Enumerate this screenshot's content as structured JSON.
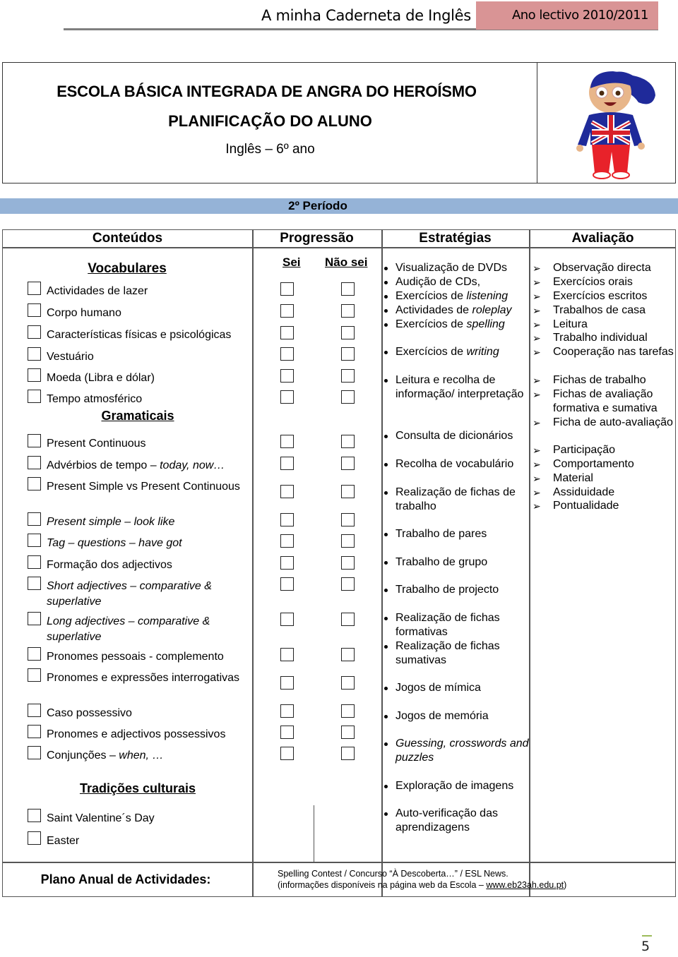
{
  "header": {
    "notebook_title": "A minha Caderneta de Inglês",
    "school_year": "Ano lectivo 2010/2011"
  },
  "school": {
    "name": "ESCOLA BÁSICA INTEGRADA DE ANGRA DO HEROÍSMO",
    "plan_title": "PLANIFICAÇÃO DO ALUNO",
    "subject": "Inglês – 6º ano",
    "mascot": "boy-union-jack-mascot"
  },
  "period": "2º Período",
  "columns": {
    "contents": "Conteúdos",
    "progress": "Progressão",
    "strategies": "Estratégias",
    "evaluation": "Avaliação"
  },
  "progress_headers": {
    "know": "Sei",
    "dont_know": "Não sei"
  },
  "sections": {
    "vocab": "Vocabulares",
    "grammar": "Gramaticais",
    "culture": "Tradições culturais"
  },
  "vocab_items": [
    {
      "text": "Actividades de lazer",
      "checked": false
    },
    {
      "text": "Corpo humano",
      "checked": false
    },
    {
      "text": "Características físicas e psicológicas",
      "checked": false
    },
    {
      "text": "Vestuário",
      "checked": false
    },
    {
      "text": "Moeda (Libra e dólar)",
      "checked": false
    },
    {
      "text": "Tempo atmosférico",
      "checked": false
    }
  ],
  "grammar_items": [
    {
      "text": "Present Continuous",
      "italic": ""
    },
    {
      "text": "Advérbios de tempo – ",
      "italic": "today, now…"
    },
    {
      "text": "Present Simple vs Present Continuous",
      "italic": ""
    },
    {
      "text": "",
      "italic": "Present simple – look like"
    },
    {
      "text": "",
      "italic": "Tag – questions – have got"
    },
    {
      "text": "Formação dos adjectivos",
      "italic": ""
    },
    {
      "text": "",
      "italic": "Short adjectives – comparative & superlative"
    },
    {
      "text": "",
      "italic": "Long adjectives – comparative & superlative"
    },
    {
      "text": "Pronomes pessoais - complemento",
      "italic": ""
    },
    {
      "text": "Pronomes e expressões interrogativas",
      "italic": ""
    },
    {
      "text": "Caso possessivo",
      "italic": ""
    },
    {
      "text": "Pronomes e adjectivos possessivos",
      "italic": ""
    },
    {
      "text": "Conjunções – ",
      "italic": "when, …"
    }
  ],
  "culture_items": [
    {
      "text": "Saint Valentine´s Day"
    },
    {
      "text": "Easter"
    }
  ],
  "strategies": [
    {
      "text": "Visualização de DVDs",
      "italic": ""
    },
    {
      "text": "Audição de CDs,",
      "italic": ""
    },
    {
      "text": "Exercícios de ",
      "italic": "listening"
    },
    {
      "text": "Actividades de ",
      "italic": "roleplay"
    },
    {
      "text": "Exercícios de ",
      "italic": "spelling"
    },
    {
      "text": "Exercícios de ",
      "italic": "writing"
    },
    {
      "text": "Leitura e recolha de informação/ interpretação",
      "italic": ""
    },
    {
      "text": "Consulta de dicionários",
      "italic": ""
    },
    {
      "text": "Recolha de vocabulário",
      "italic": ""
    },
    {
      "text": "Realização de fichas de trabalho",
      "italic": ""
    },
    {
      "text": "Trabalho de pares",
      "italic": ""
    },
    {
      "text": "Trabalho de grupo",
      "italic": ""
    },
    {
      "text": "Trabalho de projecto",
      "italic": ""
    },
    {
      "text": "Realização de fichas formativas",
      "italic": ""
    },
    {
      "text": "Realização de fichas sumativas",
      "italic": ""
    },
    {
      "text": "Jogos de mímica",
      "italic": ""
    },
    {
      "text": "Jogos de memória",
      "italic": ""
    },
    {
      "text": "",
      "italic": "Guessing, crosswords and puzzles"
    },
    {
      "text": "Exploração de imagens",
      "italic": ""
    },
    {
      "text": "Auto-verificação das aprendizagens",
      "italic": ""
    }
  ],
  "evaluation": [
    "Observação directa",
    "Exercícios orais",
    "Exercícios escritos",
    "Trabalhos de casa",
    "Leitura",
    "Trabalho individual",
    "Cooperação nas tarefas",
    "Fichas de trabalho",
    "Fichas de avaliação formativa e sumativa",
    "Ficha de auto-avaliação",
    "Participação",
    "Comportamento",
    "Material",
    "Assiduidade",
    "Pontualidade"
  ],
  "annual_plan": {
    "label": "Plano Anual de Actividades:",
    "line1": "Spelling Contest / Concurso “À Descoberta…” / ESL News.",
    "line2_prefix": "(informações disponíveis na página web da Escola – ",
    "link": "www.eb23ah.edu.pt",
    "line2_suffix": ")"
  },
  "page_number": "5"
}
